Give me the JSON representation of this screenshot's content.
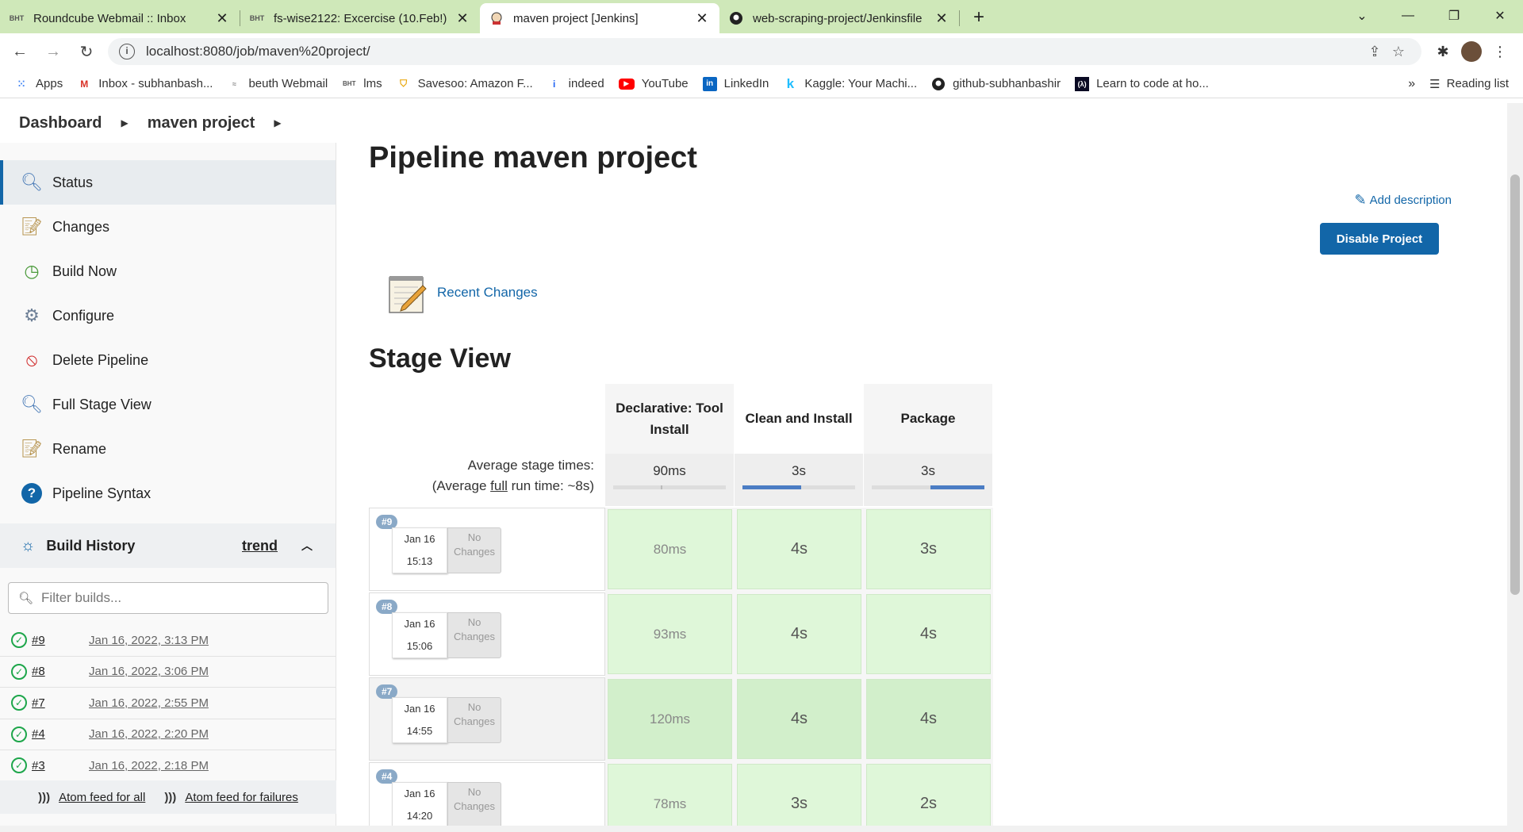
{
  "tabs": [
    {
      "fav": "BHT",
      "title": "Roundcube Webmail :: Inbox"
    },
    {
      "fav": "BHT",
      "title": "fs-wise2122: Excercise (10.Feb!)"
    },
    {
      "fav": "J",
      "title": "maven project [Jenkins]"
    },
    {
      "fav": "GH",
      "title": "web-scraping-project/Jenkinsfile"
    }
  ],
  "address": {
    "url": "localhost:8080/job/maven%20project/"
  },
  "bookmarks": [
    {
      "icon": "apps",
      "label": "Apps"
    },
    {
      "icon": "M",
      "label": "Inbox - subhanbash..."
    },
    {
      "icon": "bw",
      "label": "beuth Webmail"
    },
    {
      "icon": "BHT",
      "label": "lms"
    },
    {
      "icon": "S",
      "label": "Savesoo: Amazon F..."
    },
    {
      "icon": "i",
      "label": "indeed"
    },
    {
      "icon": "▶",
      "label": "YouTube"
    },
    {
      "icon": "in",
      "label": "LinkedIn"
    },
    {
      "icon": "k",
      "label": "Kaggle: Your Machi..."
    },
    {
      "icon": "gh",
      "label": "github-subhanbashir"
    },
    {
      "icon": "fc",
      "label": "Learn to code at ho..."
    }
  ],
  "bookmarks_more": "»",
  "reading_list": "Reading list",
  "breadcrumb": {
    "root": "Dashboard",
    "job": "maven project"
  },
  "sidebar": {
    "items": [
      {
        "icon": "magnifier",
        "label": "Status"
      },
      {
        "icon": "notepad",
        "label": "Changes"
      },
      {
        "icon": "clock",
        "label": "Build Now"
      },
      {
        "icon": "gear",
        "label": "Configure"
      },
      {
        "icon": "no-entry",
        "label": "Delete Pipeline"
      },
      {
        "icon": "magnifier",
        "label": "Full Stage View"
      },
      {
        "icon": "notepad",
        "label": "Rename"
      },
      {
        "icon": "help",
        "label": "Pipeline Syntax"
      }
    ],
    "build_history": {
      "title": "Build History",
      "trend": "trend"
    },
    "filter_placeholder": "Filter builds...",
    "builds": [
      {
        "num": "#9",
        "date": "Jan 16, 2022, 3:13 PM"
      },
      {
        "num": "#8",
        "date": "Jan 16, 2022, 3:06 PM"
      },
      {
        "num": "#7",
        "date": "Jan 16, 2022, 2:55 PM"
      },
      {
        "num": "#4",
        "date": "Jan 16, 2022, 2:20 PM"
      },
      {
        "num": "#3",
        "date": "Jan 16, 2022, 2:18 PM"
      }
    ],
    "feeds": {
      "all": "Atom feed for all",
      "failures": "Atom feed for failures"
    }
  },
  "main": {
    "title": "Pipeline maven project",
    "add_description": "Add description",
    "disable_button": "Disable Project",
    "recent_changes": "Recent Changes",
    "stage_view_title": "Stage View"
  },
  "stage_view": {
    "stages": [
      "Declarative: Tool Install",
      "Clean and Install",
      "Package"
    ],
    "avg_label": "Average stage times:",
    "avg_full_prefix": "(Average ",
    "avg_full_word": "full",
    "avg_full_suffix": " run time: ~8s)",
    "avg_times": [
      "90ms",
      "3s",
      "3s"
    ],
    "builds": [
      {
        "num": "#9",
        "date": "Jan 16",
        "time": "15:13",
        "changes": "No Changes",
        "times": [
          "80ms",
          "4s",
          "3s"
        ]
      },
      {
        "num": "#8",
        "date": "Jan 16",
        "time": "15:06",
        "changes": "No Changes",
        "times": [
          "93ms",
          "4s",
          "4s"
        ]
      },
      {
        "num": "#7",
        "date": "Jan 16",
        "time": "14:55",
        "changes": "No Changes",
        "times": [
          "120ms",
          "4s",
          "4s"
        ]
      },
      {
        "num": "#4",
        "date": "Jan 16",
        "time": "14:20",
        "changes": "No Changes",
        "times": [
          "78ms",
          "3s",
          "2s"
        ]
      }
    ]
  },
  "colors": {
    "accent": "#1266a8",
    "tab_strip": "#cfe8b9",
    "success": "#1ea64b",
    "stage_ok": "#dff7d9"
  }
}
